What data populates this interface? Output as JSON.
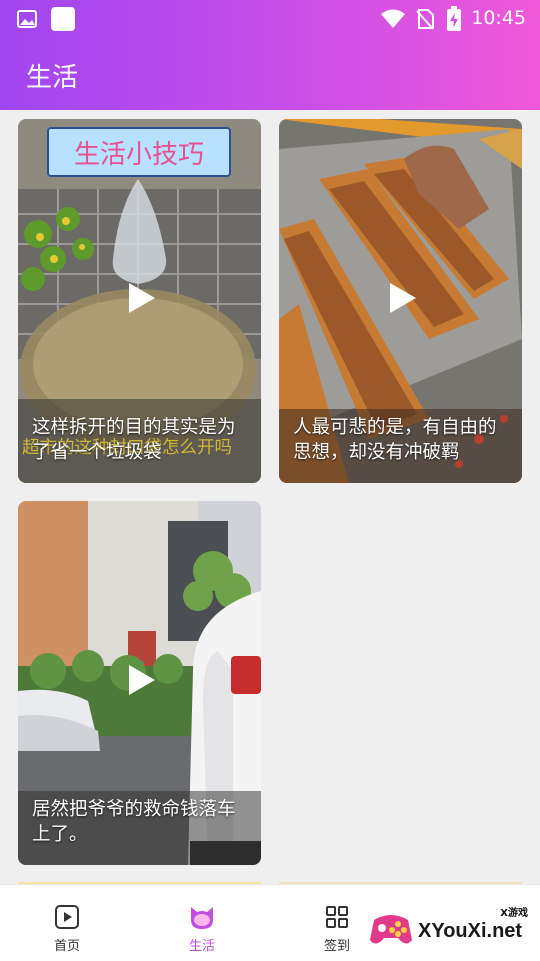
{
  "status_bar": {
    "time": "10:45"
  },
  "app_bar": {
    "title": "生活"
  },
  "videos": [
    {
      "thumb_text": "生活小技巧",
      "overlay_text": "超市的这种封口袋怎么开吗",
      "caption": "这样拆开的目的其实是为了省一个垃圾袋"
    },
    {
      "caption": "人最可悲的是，有自由的思想，却没有冲破羁"
    },
    {
      "caption": "居然把爷爷的救命钱落车上了。"
    }
  ],
  "bottom_nav": [
    {
      "label": "首页",
      "icon": "play-square-icon"
    },
    {
      "label": "生活",
      "icon": "cat-face-icon",
      "active": true
    },
    {
      "label": "签到",
      "icon": "grid-icon"
    }
  ],
  "watermark": {
    "brand": "XYouXi.net",
    "tag": "X游戏"
  },
  "colors": {
    "accent_start": "#a046f0",
    "accent_end": "#ef58d8",
    "active_tab": "#c04fe0"
  }
}
